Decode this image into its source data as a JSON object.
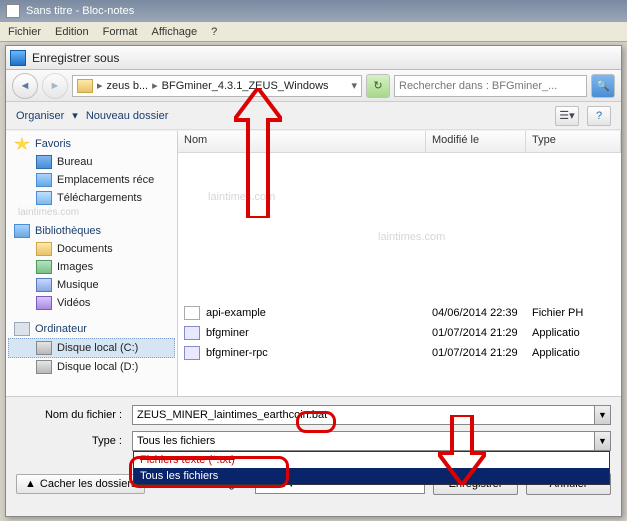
{
  "notepad": {
    "title": "Sans titre - Bloc-notes"
  },
  "menu": {
    "file": "Fichier",
    "edit": "Edition",
    "format": "Format",
    "view": "Affichage",
    "help": "?"
  },
  "dialog": {
    "title": "Enregistrer sous"
  },
  "breadcrumb": {
    "seg1": "zeus b...",
    "seg2": "BFGminer_4.3.1_ZEUS_Windows"
  },
  "search": {
    "placeholder": "Rechercher dans : BFGminer_..."
  },
  "toolbar": {
    "organize": "Organiser",
    "newfolder": "Nouveau dossier"
  },
  "columns": {
    "name": "Nom",
    "date": "Modifié le",
    "type": "Type"
  },
  "tree": {
    "favorites": "Favoris",
    "desktop": "Bureau",
    "recent": "Emplacements réce",
    "downloads": "Téléchargements",
    "libraries": "Bibliothèques",
    "documents": "Documents",
    "images": "Images",
    "music": "Musique",
    "videos": "Vidéos",
    "computer": "Ordinateur",
    "diskc": "Disque local (C:)",
    "diskd": "Disque local (D:)"
  },
  "files": [
    {
      "name": "api-example",
      "date": "04/06/2014 22:39",
      "type": "Fichier PH"
    },
    {
      "name": "bfgminer",
      "date": "01/07/2014 21:29",
      "type": "Applicatio"
    },
    {
      "name": "bfgminer-rpc",
      "date": "01/07/2014 21:29",
      "type": "Applicatio"
    }
  ],
  "form": {
    "filename_label": "Nom du fichier :",
    "filename_value": "ZEUS_MINER_laintimes_earthcoin.bat",
    "type_label": "Type :",
    "type_value": "Tous les fichiers",
    "type_opt1": "Fichiers texte (*.txt)",
    "type_opt2": "Tous les fichiers",
    "hide": "Cacher les dossiers",
    "encoding_label": "Encodage :",
    "encoding_value": "ANSI",
    "save": "Enregistrer",
    "cancel": "Annuler"
  },
  "watermark": "laintimes.com"
}
